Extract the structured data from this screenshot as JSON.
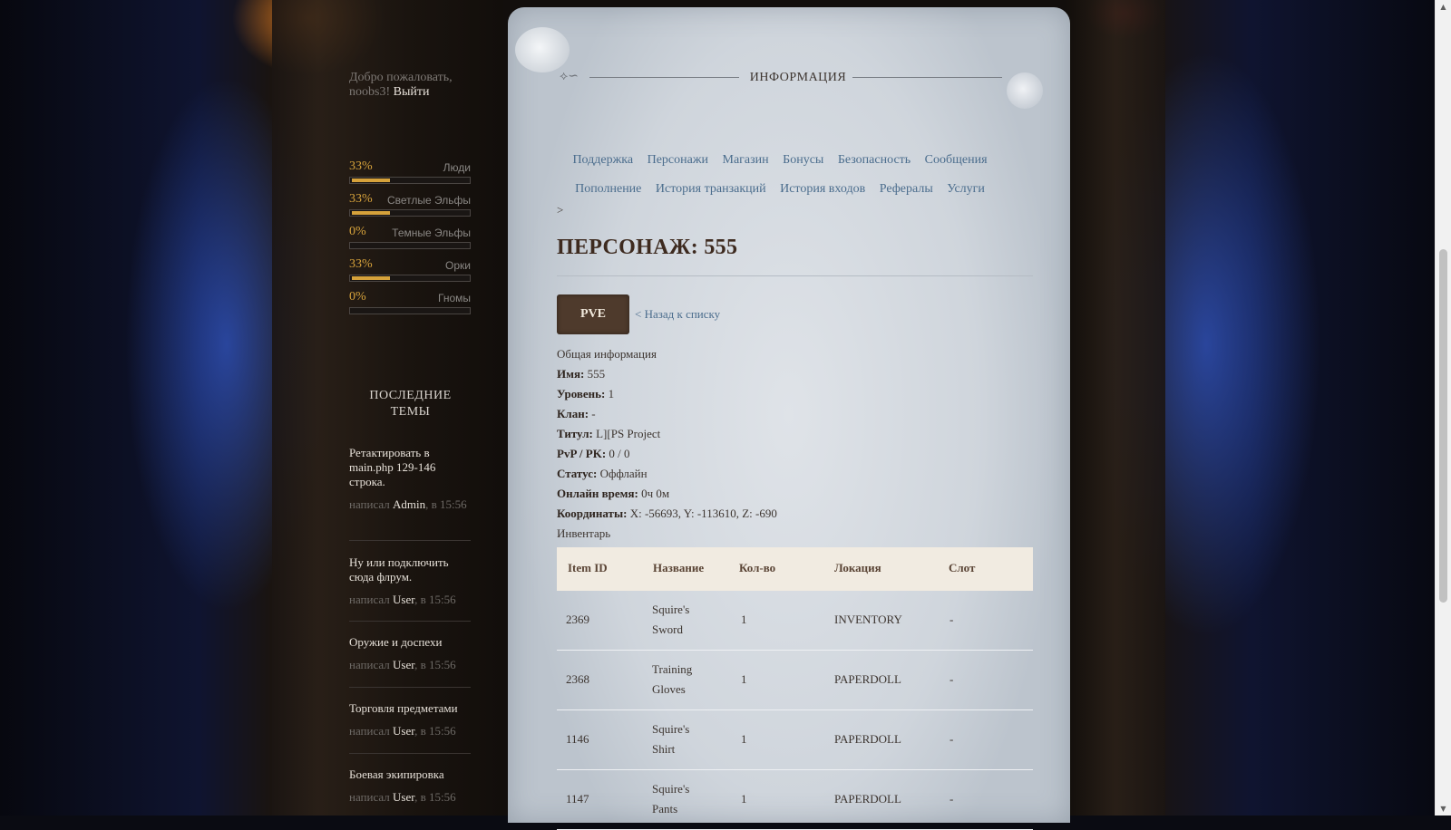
{
  "sidebar": {
    "welcome_text": "Добро пожаловать, noobs3!",
    "logout_label": "Выйти",
    "races": [
      {
        "pct": "33%",
        "name": "Люди",
        "level": 0.33
      },
      {
        "pct": "33%",
        "name": "Светлые Эльфы",
        "level": 0.33
      },
      {
        "pct": "0%",
        "name": "Темные Эльфы",
        "level": 0
      },
      {
        "pct": "33%",
        "name": "Орки",
        "level": 0.33
      },
      {
        "pct": "0%",
        "name": "Гномы",
        "level": 0
      }
    ],
    "topics_title": "ПОСЛЕДНИЕ ТЕМЫ",
    "topics": [
      {
        "title": "Ретактировать в main.php 129-146 строка.",
        "by": "написал",
        "user": "Admin",
        "time": ", в 15:56"
      },
      {
        "title": "Ну или подключить сюда флрум.",
        "by": "написал",
        "user": "User",
        "time": ", в 15:56"
      },
      {
        "title": "Оружие и доспехи",
        "by": "написал",
        "user": "User",
        "time": ", в 15:56"
      },
      {
        "title": "Торговля предметами",
        "by": "написал",
        "user": "User",
        "time": ", в 15:56"
      },
      {
        "title": "Боевая экипировка",
        "by": "написал",
        "user": "User",
        "time": ", в 15:56"
      }
    ]
  },
  "header": {
    "title": "ИНФОРМАЦИЯ"
  },
  "nav_row1": [
    "Поддержка",
    "Персонажи",
    "Магазин",
    "Бонусы",
    "Безопасность",
    "Сообщения"
  ],
  "nav_row2": [
    "Пополнение",
    "История транзакций",
    "История входов",
    "Рефералы",
    "Услуги"
  ],
  "breadcrumb": ">",
  "page_title": "ПЕРСОНАЖ: 555",
  "pve_label": "PVE",
  "back_label": "< Назад к списку",
  "info": {
    "section": "Общая информация",
    "rows": [
      {
        "label": "Имя:",
        "value": "555"
      },
      {
        "label": "Уровень:",
        "value": "1"
      },
      {
        "label": "Клан:",
        "value": "-"
      },
      {
        "label": "Титул:",
        "value": "L][PS Project"
      },
      {
        "label": "PvP / PK:",
        "value": "0 / 0"
      },
      {
        "label": "Статус:",
        "value": "Оффлайн"
      },
      {
        "label": "Онлайн время:",
        "value": "0ч 0м"
      },
      {
        "label": "Координаты:",
        "value": "X: -56693, Y: -113610, Z: -690"
      }
    ],
    "inventory_label": "Инвентарь"
  },
  "inventory": {
    "headers": [
      "Item ID",
      "Название",
      "Кол-во",
      "Локация",
      "Слот"
    ],
    "rows": [
      {
        "id": "2369",
        "name": [
          "Squire's",
          "Sword"
        ],
        "qty": "1",
        "loc": "INVENTORY",
        "slot": "-"
      },
      {
        "id": "2368",
        "name": [
          "Training",
          "Gloves"
        ],
        "qty": "1",
        "loc": "PAPERDOLL",
        "slot": "-"
      },
      {
        "id": "1146",
        "name": [
          "Squire's",
          "Shirt"
        ],
        "qty": "1",
        "loc": "PAPERDOLL",
        "slot": "-"
      },
      {
        "id": "1147",
        "name": [
          "Squire's",
          "Pants"
        ],
        "qty": "1",
        "loc": "PAPERDOLL",
        "slot": "-"
      }
    ]
  }
}
